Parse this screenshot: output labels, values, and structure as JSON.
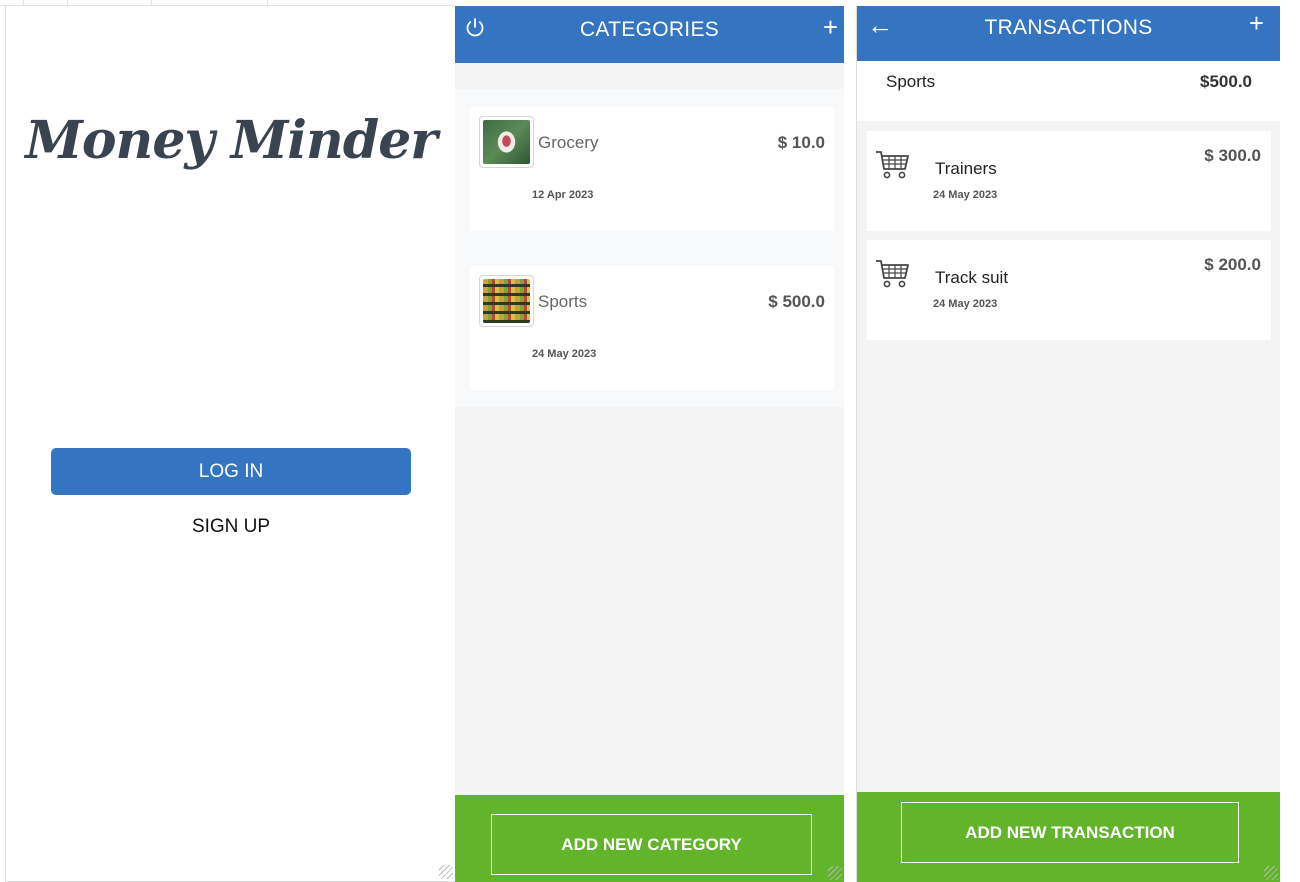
{
  "login": {
    "app_name": "Money Minder",
    "login_label": "LOG IN",
    "signup_label": "SIGN UP"
  },
  "categories": {
    "title": "CATEGORIES",
    "add_icon": "+",
    "items": [
      {
        "name": "Grocery",
        "amount": "$ 10.0",
        "date": "12 Apr 2023",
        "icon": "grocery-thumbnail"
      },
      {
        "name": "Sports",
        "amount": "$ 500.0",
        "date": "24 May 2023",
        "icon": "sports-thumbnail"
      }
    ],
    "add_button_label": "ADD NEW CATEGORY"
  },
  "transactions": {
    "title": "TRANSACTIONS",
    "add_icon": "+",
    "back_icon": "←",
    "summary": {
      "name": "Sports",
      "amount": "$500.0"
    },
    "items": [
      {
        "name": "Trainers",
        "amount": "$ 300.0",
        "date": "24 May 2023",
        "icon": "cart-icon"
      },
      {
        "name": "Track suit",
        "amount": "$ 200.0",
        "date": "24 May 2023",
        "icon": "cart-icon"
      }
    ],
    "add_button_label": "ADD NEW TRANSACTION"
  },
  "colors": {
    "primary": "#3574c0",
    "accent_green": "#62b42a",
    "background": "#f4f4f4",
    "text_dark": "#3a4350"
  }
}
